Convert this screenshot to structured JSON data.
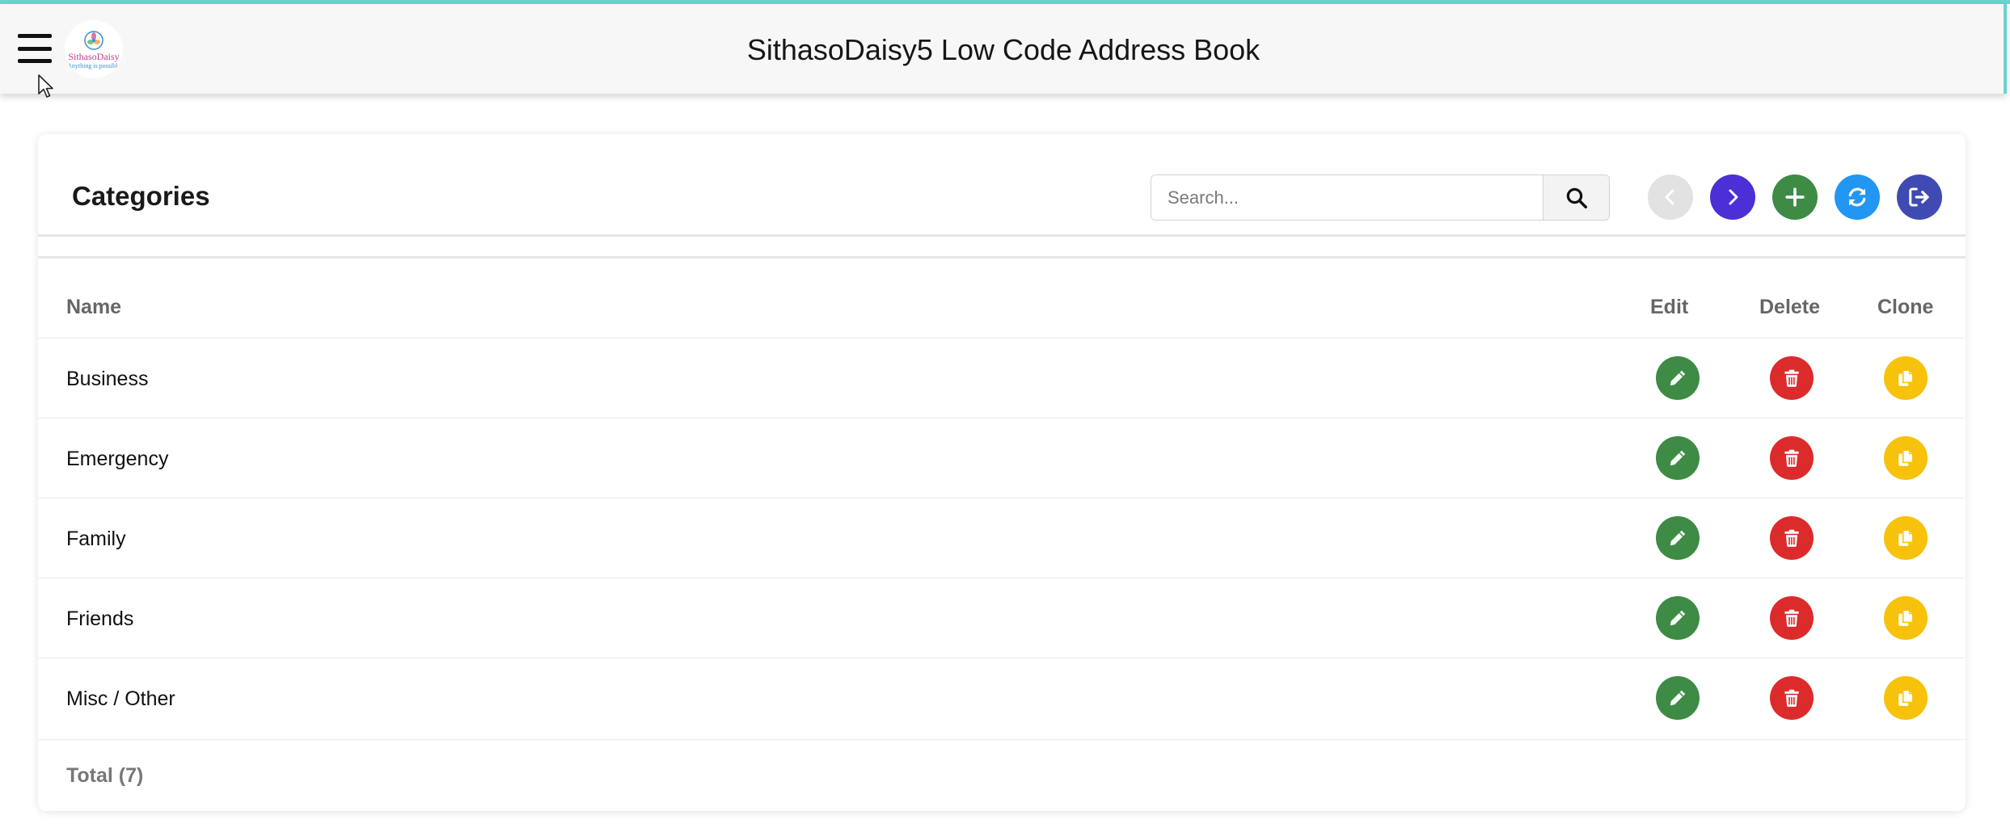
{
  "app": {
    "title": "SithasoDaisy5 Low Code Address Book"
  },
  "logo": {
    "name": "SithasoDaisy",
    "tagline": "Anything is possible"
  },
  "page": {
    "title": "Categories"
  },
  "search": {
    "placeholder": "Search...",
    "value": ""
  },
  "toolbar": {
    "prev_icon": "chevron-left-icon",
    "next_icon": "chevron-right-icon",
    "add_icon": "plus-icon",
    "refresh_icon": "refresh-icon",
    "exit_icon": "sign-out-icon"
  },
  "colors": {
    "prev": "#e2e2e2",
    "next": "#4c2fd6",
    "add": "#3d8b45",
    "refresh": "#2196f3",
    "exit": "#3f4ab3",
    "edit": "#3d8b45",
    "delete": "#dc2b2b",
    "clone": "#f7c20c"
  },
  "table": {
    "columns": [
      "Name",
      "Edit",
      "Delete",
      "Clone"
    ],
    "rows": [
      {
        "name": "Business"
      },
      {
        "name": "Emergency"
      },
      {
        "name": "Family"
      },
      {
        "name": "Friends"
      },
      {
        "name": "Misc / Other"
      }
    ],
    "footer": "Total (7)"
  }
}
